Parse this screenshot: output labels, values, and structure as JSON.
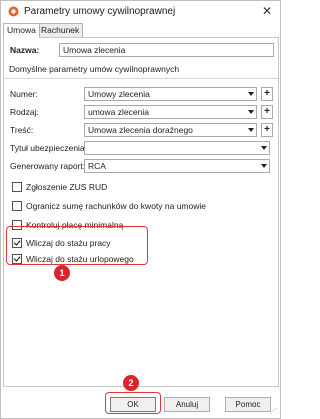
{
  "window": {
    "title": "Parametry umowy cywilnoprawnej",
    "close_symbol": "✕"
  },
  "tabs": [
    {
      "label": "Umowa",
      "active": true
    },
    {
      "label": "Rachunek",
      "active": false
    }
  ],
  "form": {
    "name_label": "Nazwa:",
    "name_value": "Umowa zlecenia",
    "section_caption": "Domyślne parametry umów cywilnoprawnych",
    "fields": [
      {
        "label": "Numer:",
        "value": "Umowy zlecenia",
        "has_plus": true
      },
      {
        "label": "Rodzaj:",
        "value": "umowa zlecenia",
        "has_plus": true
      },
      {
        "label": "Treść:",
        "value": "Umowa zlecenia doraźnego",
        "has_plus": true
      },
      {
        "label": "Tytuł ubezpieczenia:",
        "value": "",
        "has_plus": false
      },
      {
        "label": "Generowany raport:",
        "value": "RCA",
        "has_plus": false
      }
    ],
    "plus_symbol": "+",
    "checkboxes": [
      {
        "label": "Zgłoszenie ZUS RUD",
        "checked": false
      },
      {
        "label": "Ogranicz sumę rachunków do kwoty na umowie",
        "checked": false
      },
      {
        "label": "Kontroluj płacę minimalną",
        "checked": false
      },
      {
        "label": "Wliczaj do stażu pracy",
        "checked": true
      },
      {
        "label": "Wliczaj do stażu urlopowego",
        "checked": true
      }
    ]
  },
  "annotations": {
    "badge_1": "1",
    "badge_2": "2",
    "highlight_color": "#e0363a",
    "badge_color": "#d9262b"
  },
  "footer": {
    "ok_label": "OK",
    "cancel_label": "Anuluj",
    "help_label": "Pomoc"
  }
}
